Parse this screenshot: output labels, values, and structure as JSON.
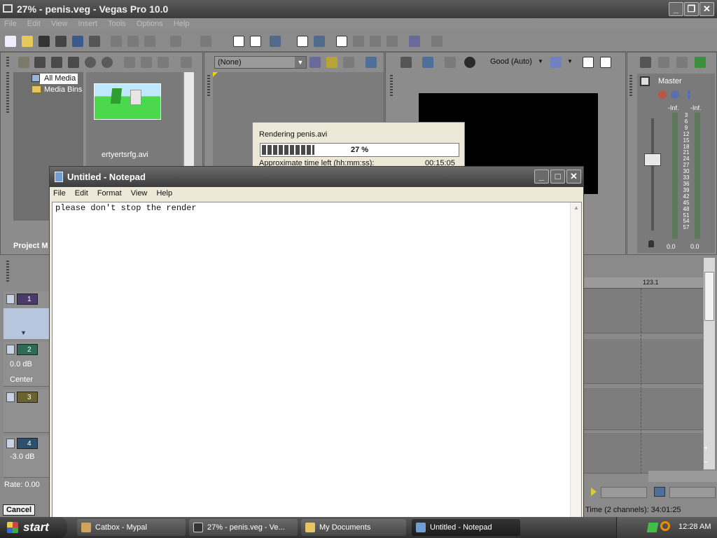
{
  "vegas": {
    "title": "27% - penis.veg - Vegas Pro 10.0",
    "menu": [
      "File",
      "Edit",
      "View",
      "Insert",
      "Tools",
      "Options",
      "Help"
    ],
    "media_tree": [
      "All Media",
      "Media Bins"
    ],
    "clip_name": "ertyertsrfg.avi",
    "project_tab": "Project M",
    "preview_dropdown": "(None)",
    "preview_quality": "Good (Auto)",
    "master_label": "Master",
    "meter_scale": [
      "-Inf.",
      "3",
      "6",
      "9",
      "12",
      "15",
      "18",
      "21",
      "24",
      "27",
      "30",
      "33",
      "36",
      "39",
      "42",
      "45",
      "48",
      "51",
      "54",
      "57"
    ],
    "meter_bottom": "0.0",
    "meter_top_left": "-Inf.",
    "meter_top_right": "-Inf.",
    "timeline_marker": "123.1",
    "tracks": [
      {
        "num": "1",
        "color": "#4a3a6a"
      },
      {
        "num": "2",
        "color": "#2f6a55",
        "db": "0.0 dB",
        "pan": "Center"
      },
      {
        "num": "3",
        "color": "#6a6230"
      },
      {
        "num": "4",
        "color": "#2c4f6e",
        "db": "-3.0 dB"
      }
    ],
    "rate": "Rate: 0.00",
    "cancel": "Cancel",
    "status": "Time (2 channels): 34:01:25"
  },
  "render": {
    "label": "Rendering penis.avi",
    "percent_text": "27 %",
    "progress": 0.27,
    "time_left_label": "Approximate time left (hh:mm:ss):",
    "time_left": "00:15:05"
  },
  "notepad": {
    "title": "Untitled - Notepad",
    "menu": [
      "File",
      "Edit",
      "Format",
      "View",
      "Help"
    ],
    "content": "please don't stop the render"
  },
  "taskbar": {
    "start": "start",
    "tasks": [
      "Catbox - Mypal",
      "27% - penis.veg - Ve...",
      "My Documents",
      "Untitled - Notepad"
    ],
    "clock": "12:28 AM"
  }
}
